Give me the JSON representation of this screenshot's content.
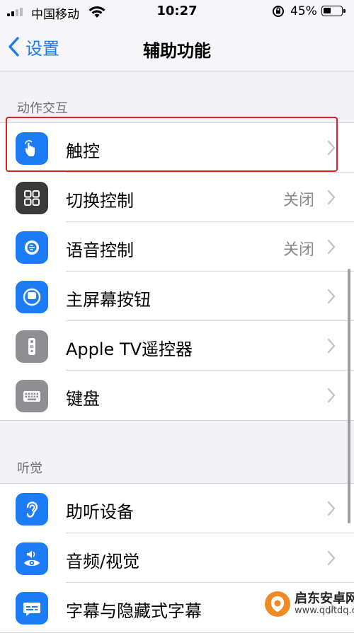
{
  "status_bar": {
    "carrier": "中国移动",
    "time": "10:27",
    "battery_percent": "45%",
    "battery_level": 0.45
  },
  "nav": {
    "back_label": "设置",
    "title": "辅助功能"
  },
  "sections": [
    {
      "header": "动作交互",
      "rows": [
        {
          "label": "触控",
          "value": "",
          "icon": "hand-touch-icon",
          "color": "#1b7cf6"
        },
        {
          "label": "切换控制",
          "value": "关闭",
          "icon": "switch-control-icon",
          "color": "#3a3a3c"
        },
        {
          "label": "语音控制",
          "value": "关闭",
          "icon": "voice-control-icon",
          "color": "#1b7cf6"
        },
        {
          "label": "主屏幕按钮",
          "value": "",
          "icon": "home-button-icon",
          "color": "#1b7cf6"
        },
        {
          "label": "Apple TV遥控器",
          "value": "",
          "icon": "tv-remote-icon",
          "color": "#8e8e93"
        },
        {
          "label": "键盘",
          "value": "",
          "icon": "keyboard-icon",
          "color": "#8e8e93"
        }
      ]
    },
    {
      "header": "听觉",
      "rows": [
        {
          "label": "助听设备",
          "value": "",
          "icon": "ear-icon",
          "color": "#1b7cf6"
        },
        {
          "label": "音频/视觉",
          "value": "",
          "icon": "audio-visual-icon",
          "color": "#1b7cf6"
        },
        {
          "label": "字幕与隐藏式字幕",
          "value": "",
          "icon": "subtitles-icon",
          "color": "#1b7cf6"
        }
      ]
    }
  ],
  "watermark": {
    "name": "启东安卓网",
    "url": "www.qdltdq.com"
  },
  "colors": {
    "accent": "#1b7cf6",
    "highlight": "#e02020",
    "background": "#f2f2f7"
  }
}
